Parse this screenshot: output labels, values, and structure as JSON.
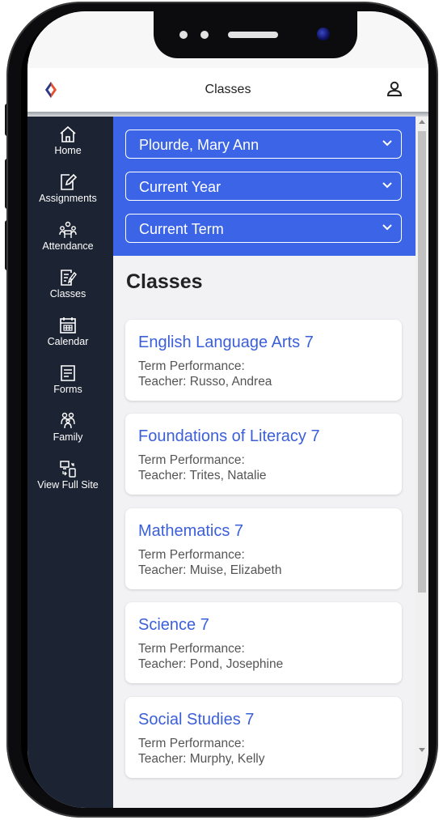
{
  "app": {
    "title": "Classes"
  },
  "colors": {
    "accent": "#3b64e6",
    "sidebar": "#1c2333",
    "link": "#3b5fd9"
  },
  "sidebar": {
    "items": [
      {
        "label": "Home",
        "icon": "home-icon"
      },
      {
        "label": "Assignments",
        "icon": "edit-icon"
      },
      {
        "label": "Attendance",
        "icon": "group-icon"
      },
      {
        "label": "Classes",
        "icon": "notes-icon"
      },
      {
        "label": "Calendar",
        "icon": "calendar-icon"
      },
      {
        "label": "Forms",
        "icon": "forms-icon"
      },
      {
        "label": "Family",
        "icon": "family-icon"
      },
      {
        "label": "View Full Site",
        "icon": "devices-icon"
      }
    ]
  },
  "filters": {
    "student": "Plourde, Mary Ann",
    "year": "Current Year",
    "term": "Current Term"
  },
  "main": {
    "heading": "Classes"
  },
  "classes": [
    {
      "name": "English Language Arts 7",
      "performance": "Term Performance:",
      "teacher": "Teacher: Russo, Andrea"
    },
    {
      "name": "Foundations of Literacy 7",
      "performance": "Term Performance:",
      "teacher": "Teacher: Trites, Natalie"
    },
    {
      "name": "Mathematics 7",
      "performance": "Term Performance:",
      "teacher": "Teacher: Muise, Elizabeth"
    },
    {
      "name": "Science 7",
      "performance": "Term Performance:",
      "teacher": "Teacher: Pond, Josephine"
    },
    {
      "name": "Social Studies 7",
      "performance": "Term Performance:",
      "teacher": "Teacher: Murphy, Kelly"
    }
  ]
}
